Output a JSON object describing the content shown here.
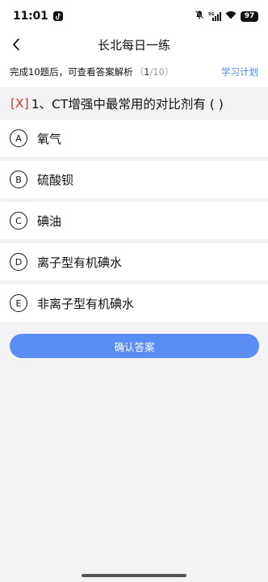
{
  "status_bar": {
    "time": "11:01",
    "network": "5G",
    "battery": "97"
  },
  "nav": {
    "title": "长北每日一练"
  },
  "info": {
    "text": "完成10题后，可查看答案解析",
    "progress_open": "（",
    "progress_current": "1",
    "progress_rest": "/10）",
    "study_plan_label": "学习计划"
  },
  "question": {
    "tag": "[X]",
    "text": "1、CT增强中最常用的对比剂有 ( )"
  },
  "options": [
    {
      "letter": "A",
      "text": "氧气"
    },
    {
      "letter": "B",
      "text": "硫酸钡"
    },
    {
      "letter": "C",
      "text": "碘油"
    },
    {
      "letter": "D",
      "text": "离子型有机碘水"
    },
    {
      "letter": "E",
      "text": "非离子型有机碘水"
    }
  ],
  "confirm_label": "确认答案",
  "colors": {
    "accent": "#5b8ef5",
    "link": "#4b86f2",
    "tag_red": "#e0342b",
    "background": "#f3f3f5"
  }
}
